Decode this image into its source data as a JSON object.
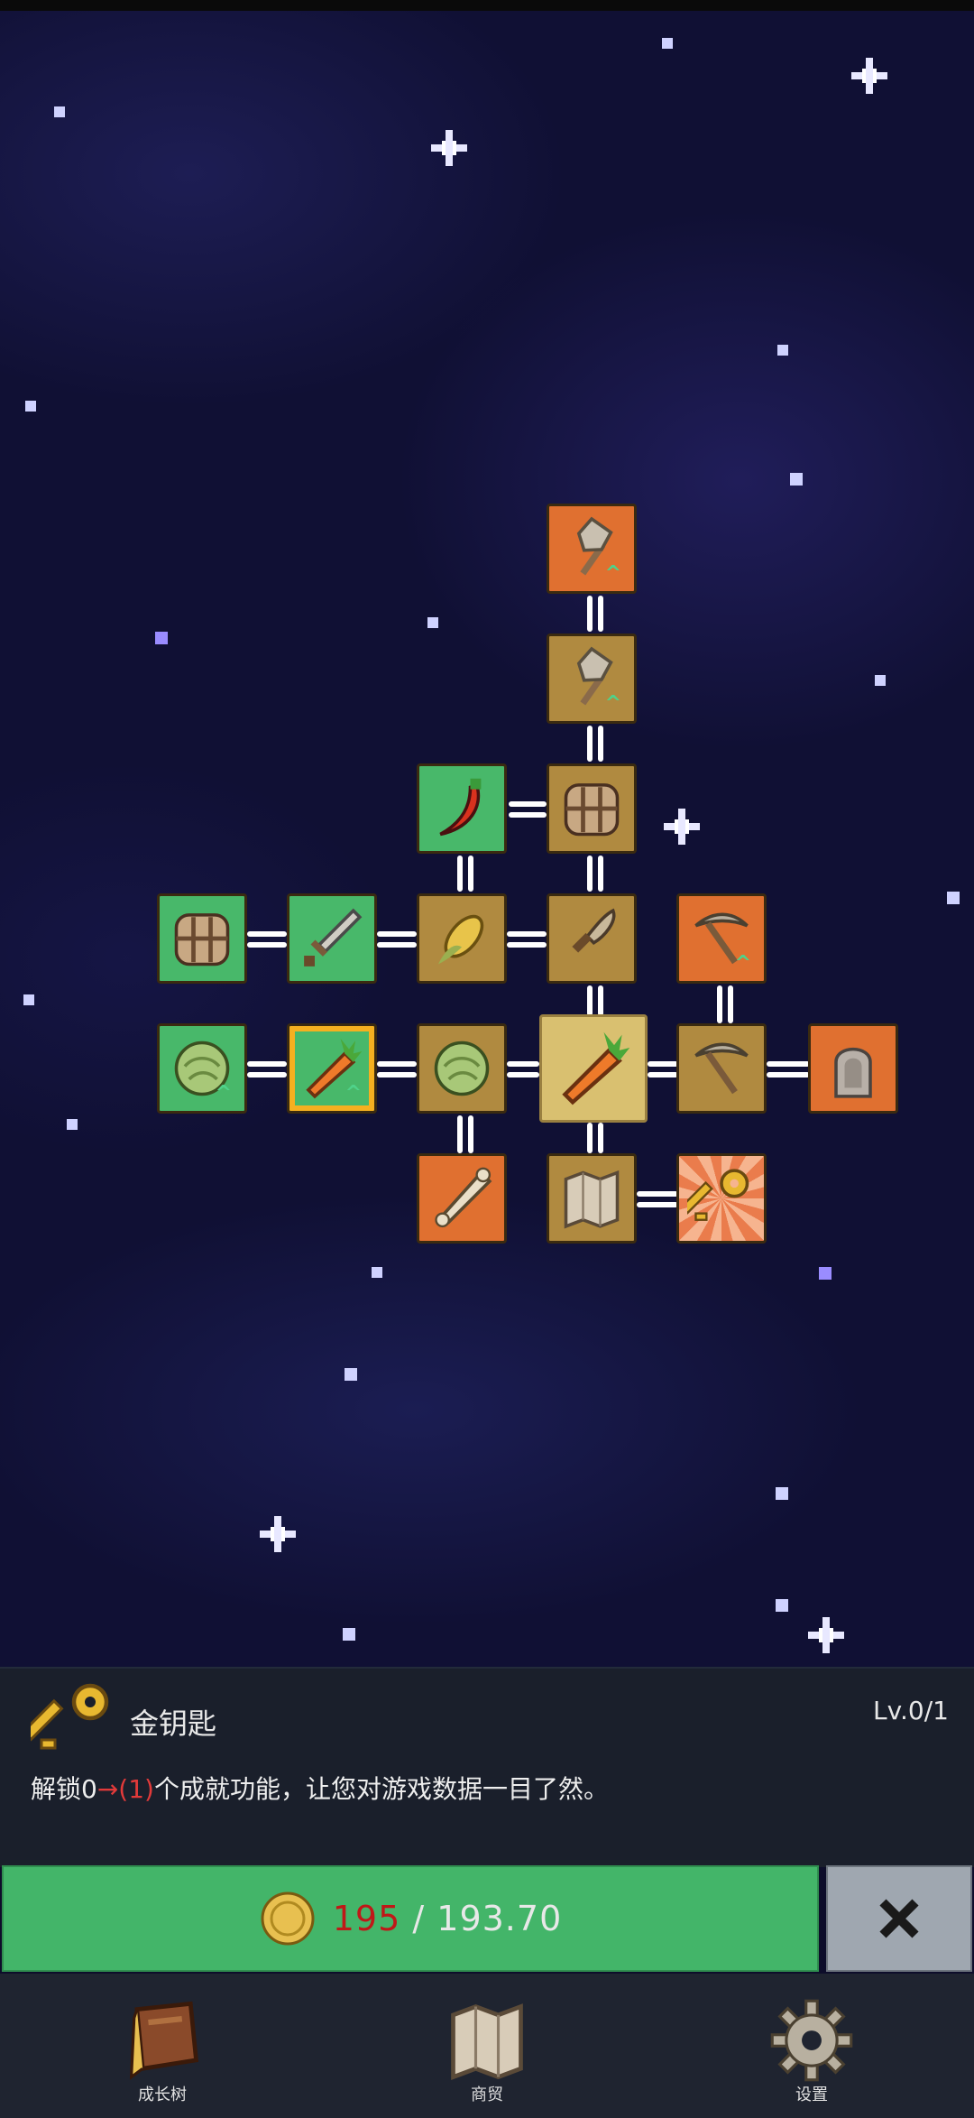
{
  "panel": {
    "item_name": "金钥匙",
    "level": "Lv.0/1",
    "desc_before": "解锁0",
    "desc_highlight": "→(1)",
    "desc_after": "个成就功能，让您对游戏数据一目了然。"
  },
  "purchase": {
    "have": "195",
    "separator": "/",
    "cost": "193.70",
    "coin_icon": "gold-coin-icon",
    "close_icon": "close-x-icon"
  },
  "nav": [
    {
      "label": "成长树",
      "icon": "book-icon"
    },
    {
      "label": "商贸",
      "icon": "map-icon"
    },
    {
      "label": "设置",
      "icon": "gear-icon"
    }
  ],
  "tree_nodes": [
    {
      "id": "shovel-upgrade-2",
      "icon": "shovel-icon",
      "color": "orange",
      "upgrade": true
    },
    {
      "id": "shovel-upgrade-1",
      "icon": "shovel-icon",
      "color": "gold",
      "upgrade": true
    },
    {
      "id": "chili",
      "icon": "chili-icon",
      "color": "green",
      "upgrade": false
    },
    {
      "id": "basket-top",
      "icon": "basket-icon",
      "color": "gold",
      "upgrade": false
    },
    {
      "id": "basket-left",
      "icon": "basket-icon",
      "color": "green",
      "upgrade": false
    },
    {
      "id": "sword",
      "icon": "sword-icon",
      "color": "green",
      "upgrade": false
    },
    {
      "id": "corn",
      "icon": "corn-icon",
      "color": "gold",
      "upgrade": false
    },
    {
      "id": "knife",
      "icon": "knife-icon",
      "color": "gold",
      "upgrade": false
    },
    {
      "id": "pickaxe-upgrade",
      "icon": "pickaxe-icon",
      "color": "orange",
      "upgrade": true
    },
    {
      "id": "cabbage-left",
      "icon": "cabbage-icon",
      "color": "green",
      "upgrade": true
    },
    {
      "id": "carrot-upgrade",
      "icon": "carrot-icon",
      "color": "green",
      "upgrade": true
    },
    {
      "id": "cabbage-mid",
      "icon": "cabbage-icon",
      "color": "gold",
      "upgrade": false
    },
    {
      "id": "carrot-center",
      "icon": "carrot-icon",
      "color": "center",
      "upgrade": false
    },
    {
      "id": "pickaxe",
      "icon": "pickaxe-icon",
      "color": "gold",
      "upgrade": false
    },
    {
      "id": "statue",
      "icon": "statue-icon",
      "color": "orange",
      "upgrade": false
    },
    {
      "id": "bone",
      "icon": "bone-icon",
      "color": "orange",
      "upgrade": false
    },
    {
      "id": "map",
      "icon": "map-icon",
      "color": "gold",
      "upgrade": false
    },
    {
      "id": "golden-key",
      "icon": "golden-key-icon",
      "color": "ray",
      "upgrade": false
    }
  ]
}
